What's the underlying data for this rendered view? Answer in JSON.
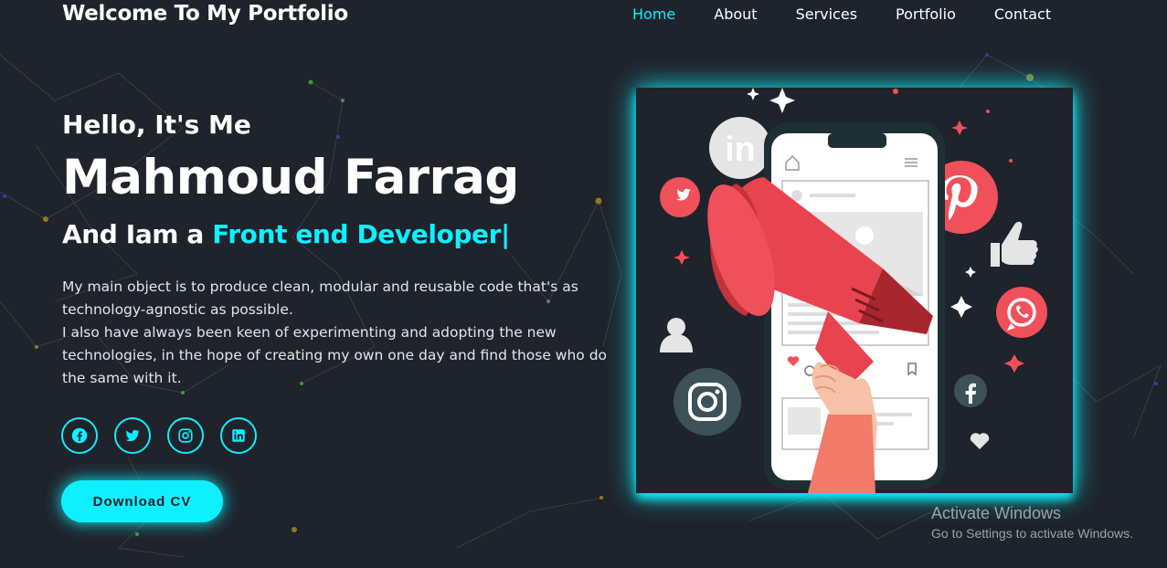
{
  "header": {
    "logo": "Welcome To My Portfolio",
    "nav": [
      "Home",
      "About",
      "Services",
      "Portfolio",
      "Contact"
    ],
    "active": "Home"
  },
  "hero": {
    "greeting": "Hello, It's Me",
    "name": "Mahmoud Farrag",
    "role_prefix": "And Iam a",
    "role_highlight": "Front end Developer",
    "caret": "|",
    "description": [
      "My main object is to produce clean, modular and reusable code that's as technology-agnostic as possible.",
      "I also have always been keen of experimenting and adopting the new technologies, in the hope of creating my own one day and find those who do the same with it."
    ],
    "social_icons": [
      "facebook-icon",
      "twitter-icon",
      "instagram-icon",
      "linkedin-icon"
    ],
    "cta_label": "Download CV"
  },
  "watermark": {
    "title": "Activate Windows",
    "subtitle": "Go to Settings to activate Windows."
  },
  "colors": {
    "background": "#1f232b",
    "accent": "#0ef0ff",
    "text": "#ffffff",
    "illustration_red": "#f0505a"
  }
}
